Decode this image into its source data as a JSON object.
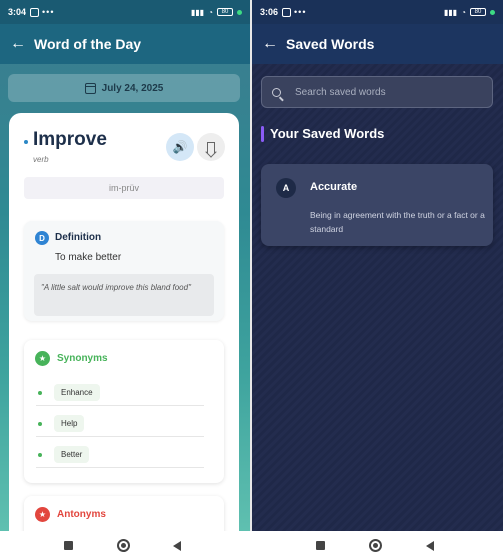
{
  "left_screen": {
    "status": {
      "time": "3:04",
      "dots": "•••",
      "battery": "80"
    },
    "appbar": {
      "back_icon": "←",
      "title": "Word of the Day"
    },
    "date": "July 24, 2025",
    "word": {
      "text": "Improve",
      "part_of_speech": "verb",
      "pronunciation": "im-prüv",
      "audio_icon": "🔊"
    },
    "definition": {
      "badge": "D",
      "title": "Definition",
      "text": "To make better",
      "example": "\"A little salt would improve this bland food\""
    },
    "synonyms": {
      "badge": "★",
      "title": "Synonyms",
      "items": [
        "Enhance",
        "Help",
        "Better"
      ]
    },
    "antonyms": {
      "badge": "★",
      "title": "Antonyms"
    },
    "colors": {
      "accent": "#2f84d3",
      "synonym": "#47b35a",
      "antonym": "#e2463e"
    }
  },
  "right_screen": {
    "status": {
      "time": "3:06",
      "dots": "•••",
      "battery": "80"
    },
    "appbar": {
      "back_icon": "←",
      "title": "Saved Words"
    },
    "search": {
      "placeholder": "Search saved words",
      "value": ""
    },
    "section_title": "Your Saved Words",
    "saved_words": [
      {
        "badge": "A",
        "word": "Accurate",
        "definition": "Being in agreement with the truth or a fact or a standard"
      }
    ],
    "colors": {
      "background": "#1f2848",
      "card": "#3b4566",
      "section_accent": "#8a5cf6"
    }
  }
}
